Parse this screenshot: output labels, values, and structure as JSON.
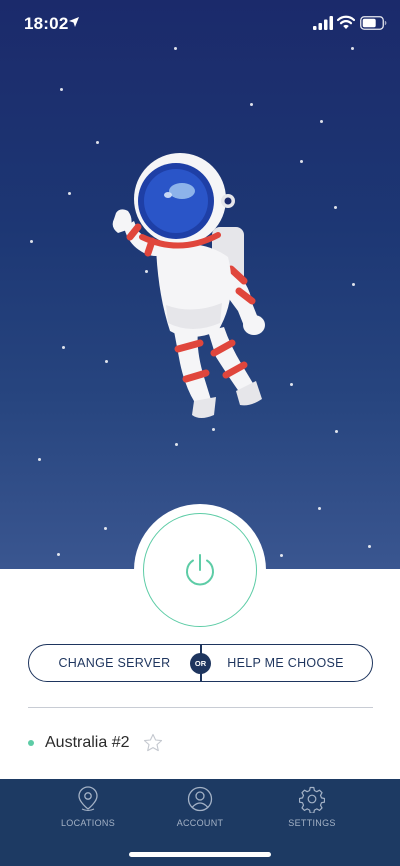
{
  "status_bar": {
    "time": "18:02",
    "location_icon": "location-arrow-icon",
    "signal_icon": "cellular-signal-icon",
    "wifi_icon": "wifi-icon",
    "battery_icon": "battery-icon"
  },
  "hero": {
    "illustration": "astronaut-illustration"
  },
  "connect": {
    "icon": "power-icon",
    "state": "disconnected",
    "accent_color": "#5dcca6"
  },
  "choice": {
    "change_server_label": "CHANGE SERVER",
    "or_label": "OR",
    "help_label": "HELP ME CHOOSE"
  },
  "current_server": {
    "name": "Australia #2",
    "status_color": "#5dcca6",
    "favorite_icon": "star-outline-icon"
  },
  "tabs": [
    {
      "label": "LOCATIONS",
      "icon": "location-pin-icon"
    },
    {
      "label": "ACCOUNT",
      "icon": "user-icon"
    },
    {
      "label": "SETTINGS",
      "icon": "gear-icon"
    }
  ],
  "colors": {
    "sky_top": "#1b2a6b",
    "sky_bottom": "#3a5690",
    "navy": "#1e355e",
    "tab_bar": "#1d3a63"
  }
}
